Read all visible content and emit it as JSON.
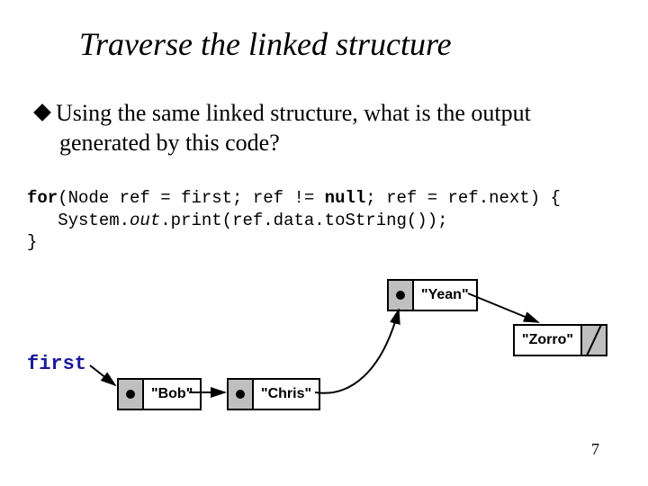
{
  "title": "Traverse the linked structure",
  "bullet": {
    "line1": "Using the same linked structure, what is the output",
    "line2": "generated by this code?"
  },
  "code": {
    "l1a": "for",
    "l1b": "(Node ref = first; ref != ",
    "l1c": "null",
    "l1d": "; ref = ref.next) {",
    "l2a": "   System.",
    "l2b": "out",
    "l2c": ".print(ref.data.toString());",
    "l3": "}"
  },
  "diagram": {
    "first_label": "first",
    "nodes": {
      "bob": "\"Bob\"",
      "chris": "\"Chris\"",
      "yean": "\"Yean\"",
      "zorro": "\"Zorro\""
    }
  },
  "page_number": "7"
}
